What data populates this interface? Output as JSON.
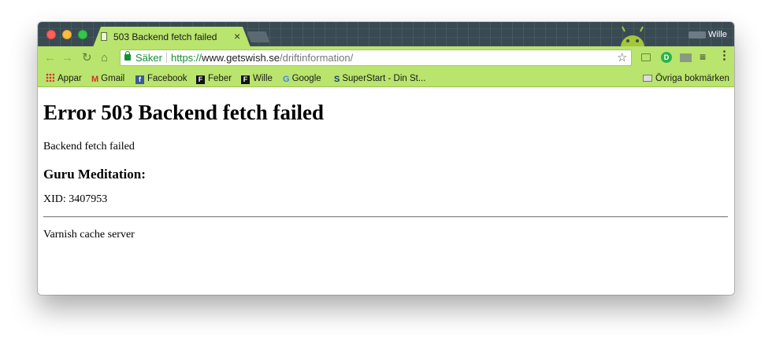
{
  "browser": {
    "tab": {
      "title": "503 Backend fetch failed",
      "close_glyph": "×"
    },
    "user": {
      "name": "Wille"
    },
    "toolbar": {
      "back_glyph": "←",
      "forward_glyph": "→",
      "reload_glyph": "↻",
      "home_glyph": "⌂",
      "security_label": "Säker",
      "url_scheme": "https://",
      "url_host": "www.getswish.se",
      "url_path": "/driftinformation/",
      "star_glyph": "☆",
      "extension_d_label": "D",
      "buffer_glyph": "≡",
      "menu_glyph": "⋮"
    },
    "bookmarks": [
      {
        "label": "Appar",
        "icon": "apps-grid-icon"
      },
      {
        "label": "Gmail",
        "icon": "gmail-icon"
      },
      {
        "label": "Facebook",
        "icon": "facebook-icon"
      },
      {
        "label": "Feber",
        "icon": "feber-icon"
      },
      {
        "label": "Wille",
        "icon": "feber-icon"
      },
      {
        "label": "Google",
        "icon": "google-icon"
      },
      {
        "label": "SuperStart - Din St...",
        "icon": "superstart-icon"
      }
    ],
    "other_bookmarks": {
      "label": "Övriga bokmärken",
      "icon": "folder-icon"
    },
    "icon_glyphs": {
      "gmail": "M",
      "facebook": "f",
      "feber": "F",
      "google": "G",
      "superstart": "S"
    },
    "theme_colors": {
      "titlebar": "#3a4a52",
      "toolbar": "#b9e46d",
      "secure": "#178e34"
    }
  },
  "page": {
    "heading": "Error 503 Backend fetch failed",
    "message": "Backend fetch failed",
    "guru_heading": "Guru Meditation:",
    "xid": "XID: 3407953",
    "footer": "Varnish cache server"
  }
}
